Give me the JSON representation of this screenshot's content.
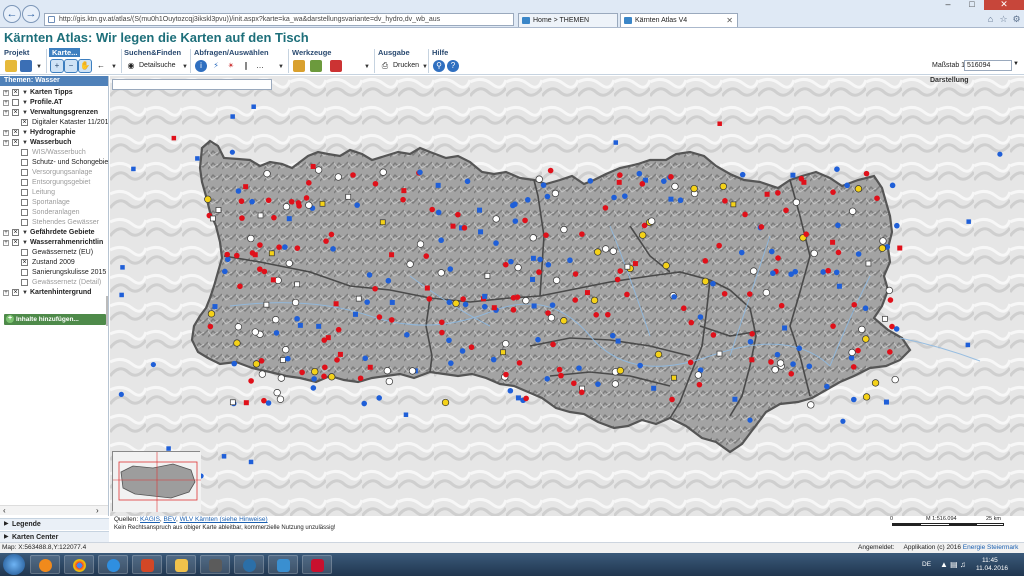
{
  "browser": {
    "address": "http://gis.ktn.gv.at/atlas/(S(mu0h1Ouytozcqj3ikskl3pvu))/init.aspx?karte=ka_wa&darstellungsvariante=dv_hydro,dv_wb_aus",
    "tabs": [
      {
        "label": "Home > THEMEN",
        "active": false
      },
      {
        "label": "Kärnten Atlas V4",
        "active": true
      }
    ]
  },
  "app": {
    "title": "Kärnten Atlas: Wir legen die Karten auf den Tisch"
  },
  "toolbar": {
    "groups": [
      {
        "label": "Projekt"
      },
      {
        "label": "Karte..."
      },
      {
        "label": "Suchen&Finden"
      },
      {
        "label": "Abfragen/Auswählen"
      },
      {
        "label": "Werkzeuge"
      },
      {
        "label": "Ausgabe"
      },
      {
        "label": "Hilfe"
      }
    ],
    "detailsuche": "Detailsuche",
    "drucken": "Drucken",
    "scale_label": "Maßstab 1:",
    "scale_value": "516094"
  },
  "sidebar": {
    "header": "Themen: Wasser",
    "layers": [
      {
        "label": "Karten Tipps",
        "style": "bold",
        "check": "x"
      },
      {
        "label": "Profile.AT",
        "style": "bold",
        "check": ""
      },
      {
        "label": "Verwaltungsgrenzen",
        "style": "bold",
        "check": "x"
      },
      {
        "label": "Digitaler Kataster 11/201",
        "style": "normal",
        "check": "x"
      },
      {
        "label": "Hydrographie",
        "style": "bold",
        "check": "x"
      },
      {
        "label": "Wasserbuch",
        "style": "bold",
        "check": "x"
      },
      {
        "label": "WIS/Wasserbuch",
        "style": "grey",
        "check": ""
      },
      {
        "label": "Schutz- und Schongebiet",
        "style": "normal",
        "check": ""
      },
      {
        "label": "Versorgungsanlage",
        "style": "grey",
        "check": ""
      },
      {
        "label": "Entsorgungsgebiet",
        "style": "grey",
        "check": ""
      },
      {
        "label": "Leitung",
        "style": "grey",
        "check": ""
      },
      {
        "label": "Sportanlage",
        "style": "grey",
        "check": ""
      },
      {
        "label": "Sonderanlagen",
        "style": "grey",
        "check": ""
      },
      {
        "label": "Stehendes Gewässer",
        "style": "grey",
        "check": ""
      },
      {
        "label": "Gefährdete Gebiete",
        "style": "bold",
        "check": "x"
      },
      {
        "label": "Wasserrahmenrichtlin",
        "style": "bold",
        "check": "x"
      },
      {
        "label": "Gewässernetz (EU)",
        "style": "normal",
        "check": ""
      },
      {
        "label": "Zustand 2009",
        "style": "normal",
        "check": "x"
      },
      {
        "label": "Sanierungskulisse 2015",
        "style": "normal",
        "check": ""
      },
      {
        "label": "Gewässernetz (Detail)",
        "style": "grey",
        "check": ""
      },
      {
        "label": "Kartenhintergrund",
        "style": "bold",
        "check": "x"
      }
    ],
    "add_content": "Inhalte hinzufügen...",
    "accordion": [
      {
        "label": "Legende"
      },
      {
        "label": "Karten Center"
      }
    ]
  },
  "map": {
    "darstellung": "Darstellung",
    "sources_prefix": "Quellen:",
    "sources_links": [
      "KAGIS",
      "BEV",
      "WLV Kärnten (siehe Hinweise)"
    ],
    "disclaimer": "Kein Rechtsanspruch aus obiger Karte ableitbar, kommerzielle Nutzung unzulässig!",
    "scale_text": "M 1:516.094",
    "scale_start": "0",
    "scale_end": "25 km"
  },
  "status": {
    "coords": "Map: X:563488.8,Y:122077.4",
    "logged_in": "Angemeldet:",
    "app_credit": "Applikation (c) 2016",
    "credit_link": "Energie Steiermark"
  },
  "taskbar": {
    "lang": "DE",
    "time": "11:45",
    "date": "11.04.2016"
  },
  "colors": {
    "title": "#1d6f7a",
    "sidebar_header": "#4f81b9",
    "point_red": "#e0101a",
    "point_blue": "#1f5fd8",
    "point_yellow": "#f5d218",
    "region_fill": "#9a9a9a"
  }
}
